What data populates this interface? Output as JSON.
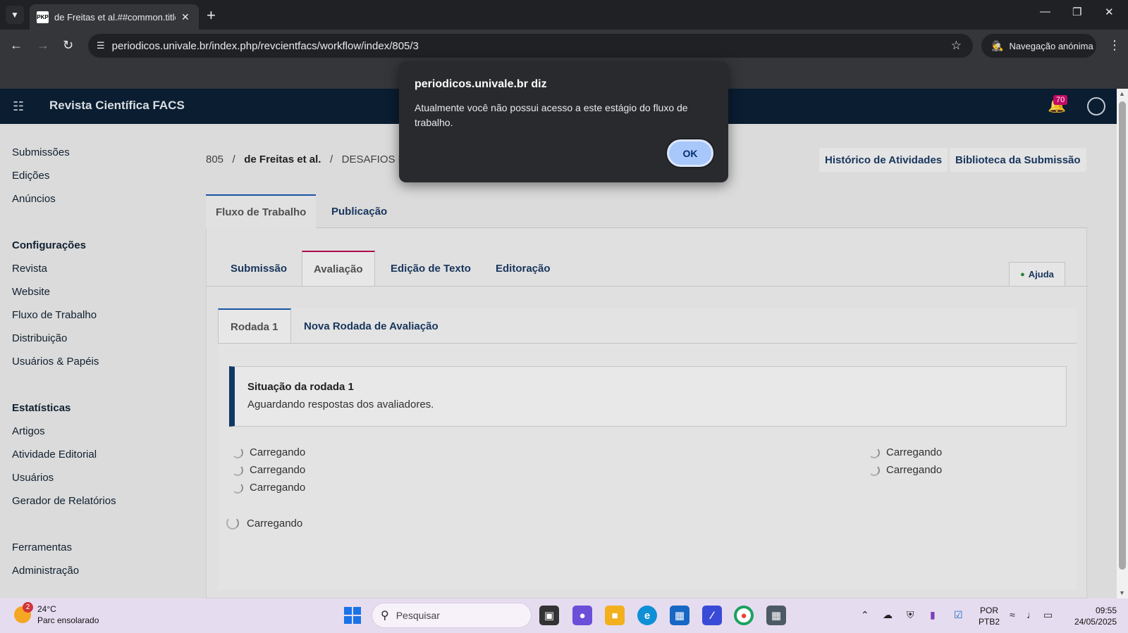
{
  "browser": {
    "tab_title": "de Freitas et al.##common.title",
    "tab_favicon": "PKP",
    "url": "periodicos.univale.br/index.php/revcientfacs/workflow/index/805/3",
    "incognito_label": "Navegação anónima"
  },
  "header": {
    "journal_name": "Revista Científica FACS",
    "notification_count": "70"
  },
  "sidebar": {
    "main": [
      "Submissões",
      "Edições",
      "Anúncios"
    ],
    "config_heading": "Configurações",
    "config": [
      "Revista",
      "Website",
      "Fluxo de Trabalho",
      "Distribuição",
      "Usuários & Papéis"
    ],
    "stats_heading": "Estatísticas",
    "stats": [
      "Artigos",
      "Atividade Editorial",
      "Usuários",
      "Gerador de Relatórios"
    ],
    "tools": [
      "Ferramentas",
      "Administração"
    ]
  },
  "breadcrumb": {
    "id": "805",
    "author": "de Freitas et al.",
    "title": "DESAFIOS E POSSIBILIDADES DA ASSISTÊNCIA À SAÚDE: ",
    "sep": "/"
  },
  "actions": {
    "history": "Histórico de Atividades",
    "library": "Biblioteca da Submissão"
  },
  "main_tabs": [
    "Fluxo de Trabalho",
    "Publicação"
  ],
  "stage_tabs": [
    "Submissão",
    "Avaliação",
    "Edição de Texto",
    "Editoração"
  ],
  "help_label": "Ajuda",
  "round_tabs": [
    "Rodada 1",
    "Nova Rodada de Avaliação"
  ],
  "round_status": {
    "title": "Situação da rodada 1",
    "message": "Aguardando respostas dos avaliadores."
  },
  "loading_label": "Carregando",
  "dialog": {
    "title": "periodicos.univale.br diz",
    "message": "Atualmente você não possui acesso a este estágio do fluxo de trabalho.",
    "ok": "OK"
  },
  "taskbar": {
    "weather_temp": "24°C",
    "weather_desc": "Parc ensolarado",
    "weather_alerts": "2",
    "search_placeholder": "Pesquisar",
    "lang_top": "POR",
    "lang_bottom": "PTB2",
    "time": "09:55",
    "date": "24/05/2025"
  },
  "colors": {
    "header_bg": "#0b1f35",
    "link": "#1b3a63",
    "accent_review": "#b80c54",
    "ok_button": "#a8c7fa"
  }
}
